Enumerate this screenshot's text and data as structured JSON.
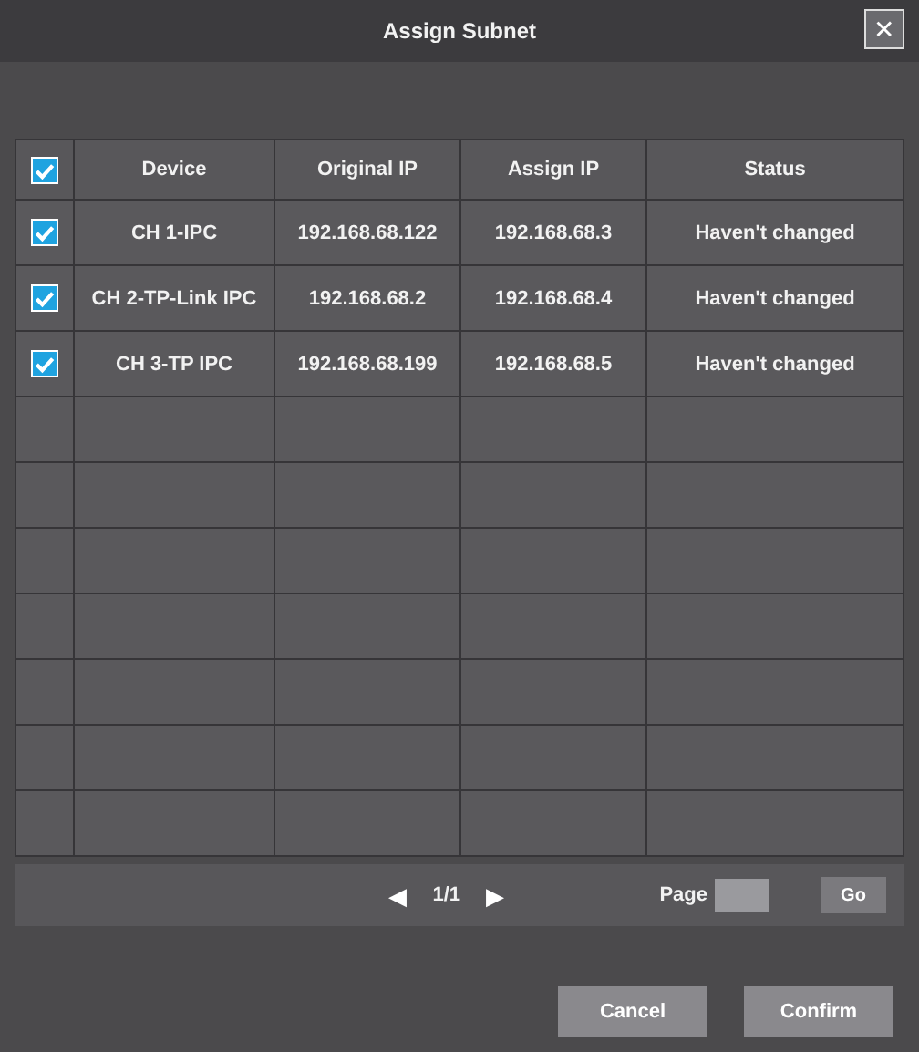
{
  "window": {
    "title": "Assign Subnet",
    "close": "✕"
  },
  "table": {
    "all_checked": true,
    "columns": [
      "Device",
      "Original IP",
      "Assign IP",
      "Status"
    ],
    "rows": [
      {
        "checked": true,
        "cells": [
          "CH 1-IPC",
          "192.168.68.122",
          "192.168.68.3",
          "Haven't changed"
        ]
      },
      {
        "checked": true,
        "cells": [
          "CH 2-TP-Link IPC",
          "192.168.68.2",
          "192.168.68.4",
          "Haven't changed"
        ]
      },
      {
        "checked": true,
        "cells": [
          "CH 3-TP IPC",
          "192.168.68.199",
          "192.168.68.5",
          "Haven't changed"
        ]
      }
    ]
  },
  "pager": {
    "prev": "◀",
    "page": "1/1",
    "next": "▶",
    "page_label": "Page",
    "go": "Go"
  },
  "buttons": [
    "Cancel",
    "Confirm"
  ]
}
